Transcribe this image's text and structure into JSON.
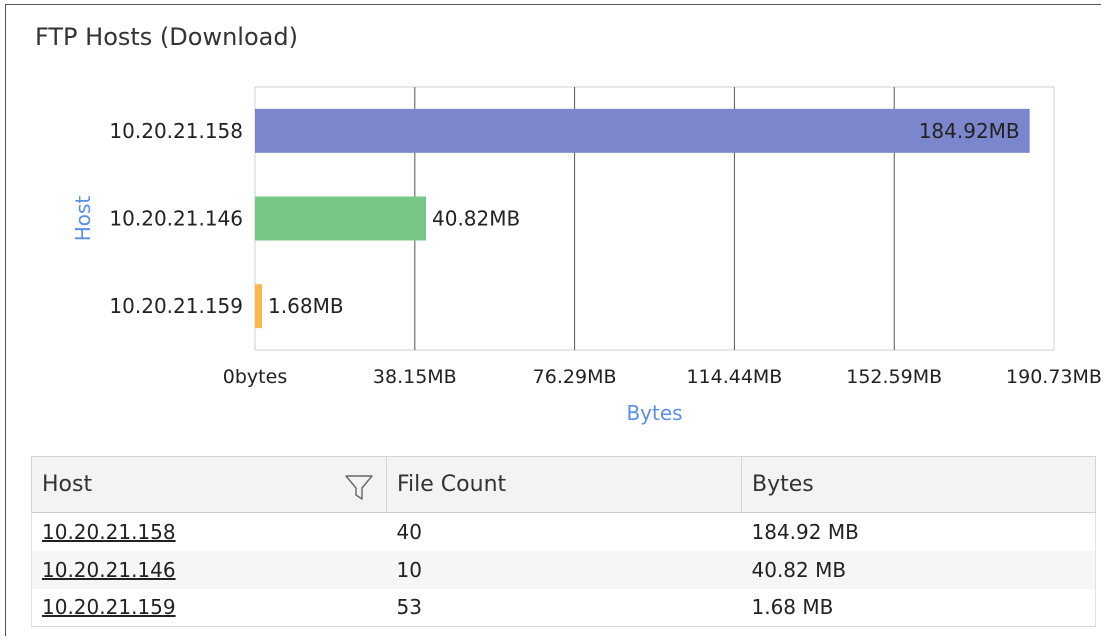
{
  "panel": {
    "title": "FTP Hosts (Download)"
  },
  "chart_data": {
    "type": "bar",
    "orientation": "horizontal",
    "title": "",
    "xlabel": "Bytes",
    "ylabel": "Host",
    "categories": [
      "10.20.21.158",
      "10.20.21.146",
      "10.20.21.159"
    ],
    "values": [
      184.92,
      40.82,
      1.68
    ],
    "value_unit": "MB",
    "data_labels": [
      "184.92MB",
      "40.82MB",
      "1.68MB"
    ],
    "colors": [
      "#7b86cc",
      "#77c886",
      "#fbb64c"
    ],
    "xlim": [
      0,
      190.73
    ],
    "x_ticks": [
      0,
      38.15,
      76.29,
      114.44,
      152.59,
      190.73
    ],
    "x_tick_labels": [
      "0bytes",
      "38.15MB",
      "76.29MB",
      "114.44MB",
      "152.59MB",
      "190.73MB"
    ],
    "grid": "vertical",
    "axis_title_color": "#5b8ee6"
  },
  "table": {
    "columns": [
      "Host",
      "File Count",
      "Bytes"
    ],
    "rows": [
      {
        "host": "10.20.21.158",
        "file_count": "40",
        "bytes": "184.92 MB"
      },
      {
        "host": "10.20.21.146",
        "file_count": "10",
        "bytes": "40.82 MB"
      },
      {
        "host": "10.20.21.159",
        "file_count": "53",
        "bytes": "1.68 MB"
      }
    ],
    "icons": {
      "host_column": "filter-icon"
    }
  }
}
